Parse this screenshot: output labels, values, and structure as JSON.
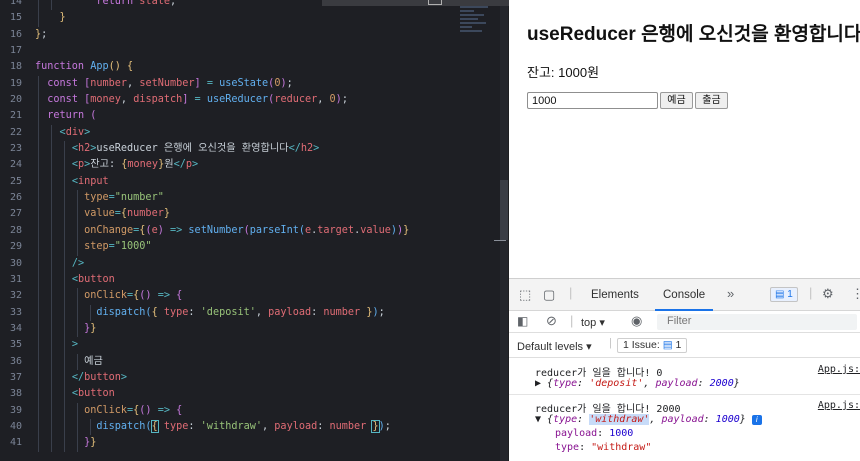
{
  "editor": {
    "line_numbers": [
      "14",
      "15",
      "16",
      "17",
      "18",
      "19",
      "20",
      "21",
      "22",
      "23",
      "24",
      "25",
      "26",
      "27",
      "28",
      "29",
      "30",
      "31",
      "32",
      "33",
      "34",
      "35",
      "36",
      "37",
      "38",
      "39",
      "40",
      "41"
    ]
  },
  "browser": {
    "title_bold": "useReducer",
    "title_rest": "은행에 오신것을 환영합니다",
    "balance_label": "잔고:",
    "balance_value": "1000",
    "balance_unit": "원",
    "amount_input_value": "1000",
    "deposit_label": "예금",
    "withdraw_label": "출금"
  },
  "devtools": {
    "tabs": [
      "Elements",
      "Console"
    ],
    "more": "»",
    "message_badge": "1",
    "context": "top",
    "filter_placeholder": "Filter",
    "levels_label": "Default levels",
    "issues_label": "1 Issue:",
    "issues_count": "1",
    "logs": [
      {
        "message": "reducer가 일을 합니다! 0",
        "source": "App.js:",
        "object_type": "'deposit'",
        "object_payload": "2000"
      },
      {
        "message": "reducer가 일을 합니다! 2000",
        "source": "App.js:",
        "object_type": "'withdraw'",
        "object_payload": "1000",
        "expanded_payload_key": "payload",
        "expanded_payload_value": "1000",
        "expanded_type_key": "type",
        "expanded_type_value": "\"withdraw\""
      }
    ]
  }
}
